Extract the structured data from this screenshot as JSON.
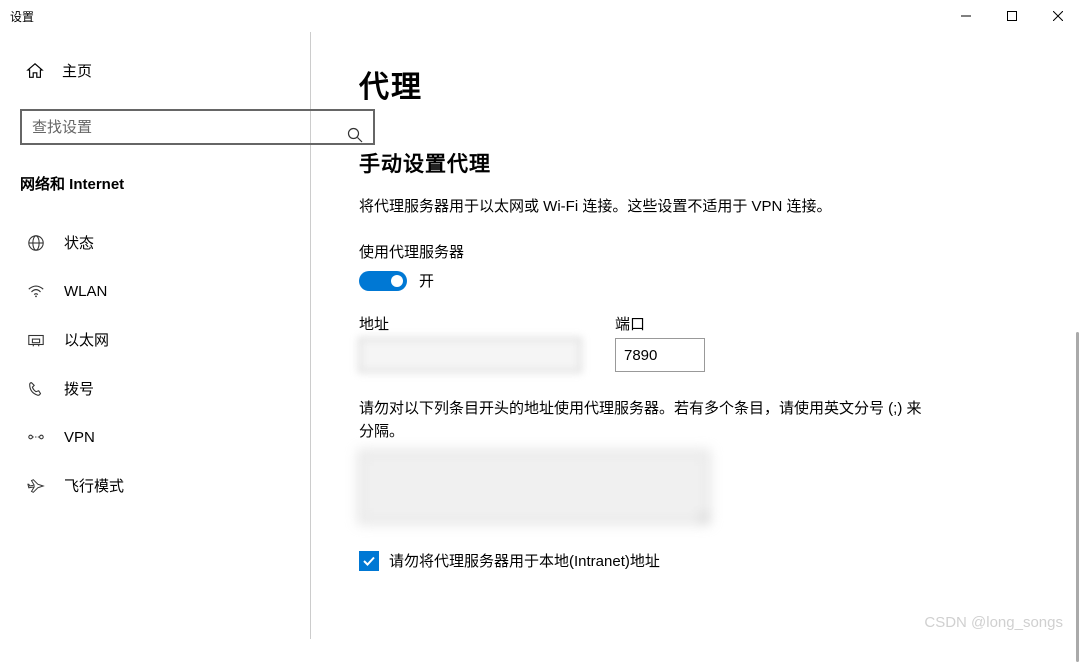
{
  "window": {
    "title": "设置"
  },
  "sidebar": {
    "home": "主页",
    "search_placeholder": "查找设置",
    "category": "网络和 Internet",
    "items": [
      {
        "label": "状态"
      },
      {
        "label": "WLAN"
      },
      {
        "label": "以太网"
      },
      {
        "label": "拨号"
      },
      {
        "label": "VPN"
      },
      {
        "label": "飞行模式"
      }
    ]
  },
  "main": {
    "title": "代理",
    "section_title": "手动设置代理",
    "description": "将代理服务器用于以太网或 Wi-Fi 连接。这些设置不适用于 VPN 连接。",
    "toggle_label": "使用代理服务器",
    "toggle_state": "开",
    "address_label": "地址",
    "port_label": "端口",
    "port_value": "7890",
    "exceptions_text": "请勿对以下列条目开头的地址使用代理服务器。若有多个条目，请使用英文分号 (;) 来分隔。",
    "checkbox_label": "请勿将代理服务器用于本地(Intranet)地址"
  },
  "watermark": "CSDN @long_songs"
}
